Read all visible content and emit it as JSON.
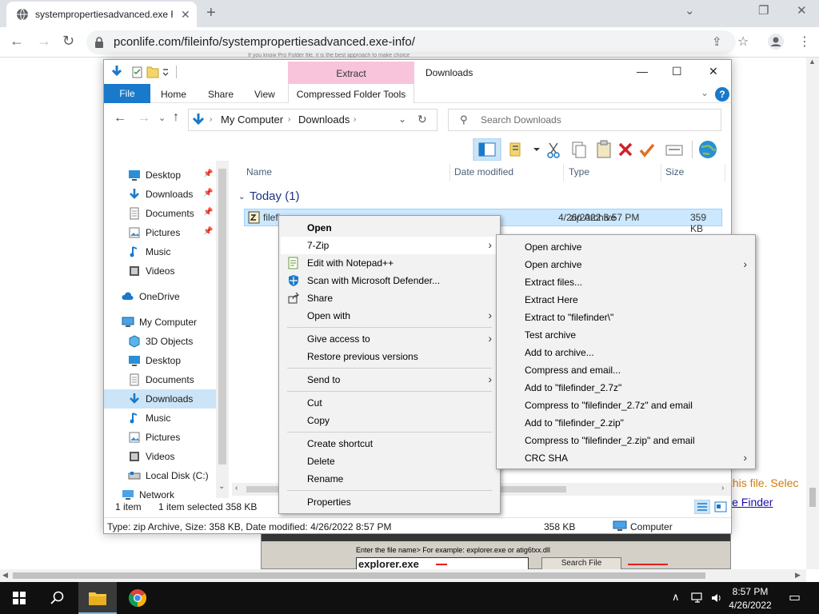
{
  "browser": {
    "tab_title": "systempropertiesadvanced.exe F",
    "url": "pconlife.com/fileinfo/systempropertiesadvanced.exe-info/"
  },
  "page": {
    "top_snippet": "If you know Pro Folder file, it is the best approach to make choice",
    "orange_text": "this file. Selec",
    "link_text": "le Finder",
    "filefinder": {
      "label": "Enter the file name>  For example: explorer.exe or atig6txx.dll",
      "input_value": "explorer.exe",
      "button": "Search File"
    }
  },
  "explorer": {
    "window_title": "Downloads",
    "context_tab": "Extract",
    "context_tools": "Compressed Folder Tools",
    "ribbon_tabs": [
      "File",
      "Home",
      "Share",
      "View"
    ],
    "breadcrumb": [
      "My Computer",
      "Downloads"
    ],
    "search_placeholder": "Search Downloads",
    "nav": [
      {
        "label": "Desktop",
        "icon": "desktop-icon",
        "pinned": true
      },
      {
        "label": "Downloads",
        "icon": "downloads-icon",
        "pinned": true
      },
      {
        "label": "Documents",
        "icon": "documents-icon",
        "pinned": true
      },
      {
        "label": "Pictures",
        "icon": "pictures-icon",
        "pinned": true
      },
      {
        "label": "Music",
        "icon": "music-icon"
      },
      {
        "label": "Videos",
        "icon": "videos-icon"
      },
      {
        "label": "OneDrive",
        "icon": "onedrive-icon"
      },
      {
        "label": "My Computer",
        "icon": "computer-icon"
      },
      {
        "label": "3D Objects",
        "icon": "3d-objects-icon"
      },
      {
        "label": "Desktop",
        "icon": "desktop-icon"
      },
      {
        "label": "Documents",
        "icon": "documents-icon"
      },
      {
        "label": "Downloads",
        "icon": "downloads-icon",
        "selected": true
      },
      {
        "label": "Music",
        "icon": "music-icon"
      },
      {
        "label": "Pictures",
        "icon": "pictures-icon"
      },
      {
        "label": "Videos",
        "icon": "videos-icon"
      },
      {
        "label": "Local Disk (C:)",
        "icon": "local-disk-icon"
      },
      {
        "label": "Network",
        "icon": "network-icon"
      }
    ],
    "columns": [
      "Name",
      "Date modified",
      "Type",
      "Size"
    ],
    "group": "Today (1)",
    "file": {
      "name": "filefin",
      "date": "4/26/2022 8:57 PM",
      "type": "zip Archive",
      "size": "359 KB"
    },
    "status": {
      "items": "1 item",
      "selected": "1 item selected  358 KB"
    },
    "details": {
      "text": "Type: zip Archive, Size: 358 KB, Date modified: 4/26/2022 8:57 PM",
      "size": "358 KB",
      "location": "Computer"
    }
  },
  "context_menu": {
    "items": [
      {
        "label": "Open",
        "bold": true
      },
      {
        "label": "7-Zip",
        "submenu": true,
        "highlight": true
      },
      {
        "label": "Edit with Notepad++",
        "icon": "notepad-plus-icon"
      },
      {
        "label": "Scan with Microsoft Defender...",
        "icon": "defender-shield-icon"
      },
      {
        "label": "Share",
        "icon": "share-icon"
      },
      {
        "label": "Open with",
        "submenu": true
      },
      {
        "sep": true
      },
      {
        "label": "Give access to",
        "submenu": true
      },
      {
        "label": "Restore previous versions"
      },
      {
        "sep": true
      },
      {
        "label": "Send to",
        "submenu": true
      },
      {
        "sep": true
      },
      {
        "label": "Cut"
      },
      {
        "label": "Copy"
      },
      {
        "sep": true
      },
      {
        "label": "Create shortcut"
      },
      {
        "label": "Delete"
      },
      {
        "label": "Rename"
      },
      {
        "sep": true
      },
      {
        "label": "Properties"
      }
    ]
  },
  "submenu_7zip": {
    "items": [
      {
        "label": "Open archive"
      },
      {
        "label": "Open archive",
        "submenu": true
      },
      {
        "label": "Extract files..."
      },
      {
        "label": "Extract Here"
      },
      {
        "label": "Extract to \"filefinder\\\""
      },
      {
        "label": "Test archive"
      },
      {
        "label": "Add to archive..."
      },
      {
        "label": "Compress and email..."
      },
      {
        "label": "Add to \"filefinder_2.7z\""
      },
      {
        "label": "Compress to \"filefinder_2.7z\" and email"
      },
      {
        "label": "Add to \"filefinder_2.zip\""
      },
      {
        "label": "Compress to \"filefinder_2.zip\" and email"
      },
      {
        "label": "CRC SHA",
        "submenu": true
      }
    ]
  },
  "taskbar": {
    "time": "8:57 PM",
    "date": "4/26/2022"
  },
  "colors": {
    "accent": "#1979ca",
    "selection": "#cce8ff",
    "context_tab": "#f8c4dc",
    "taskbar": "#101010"
  }
}
